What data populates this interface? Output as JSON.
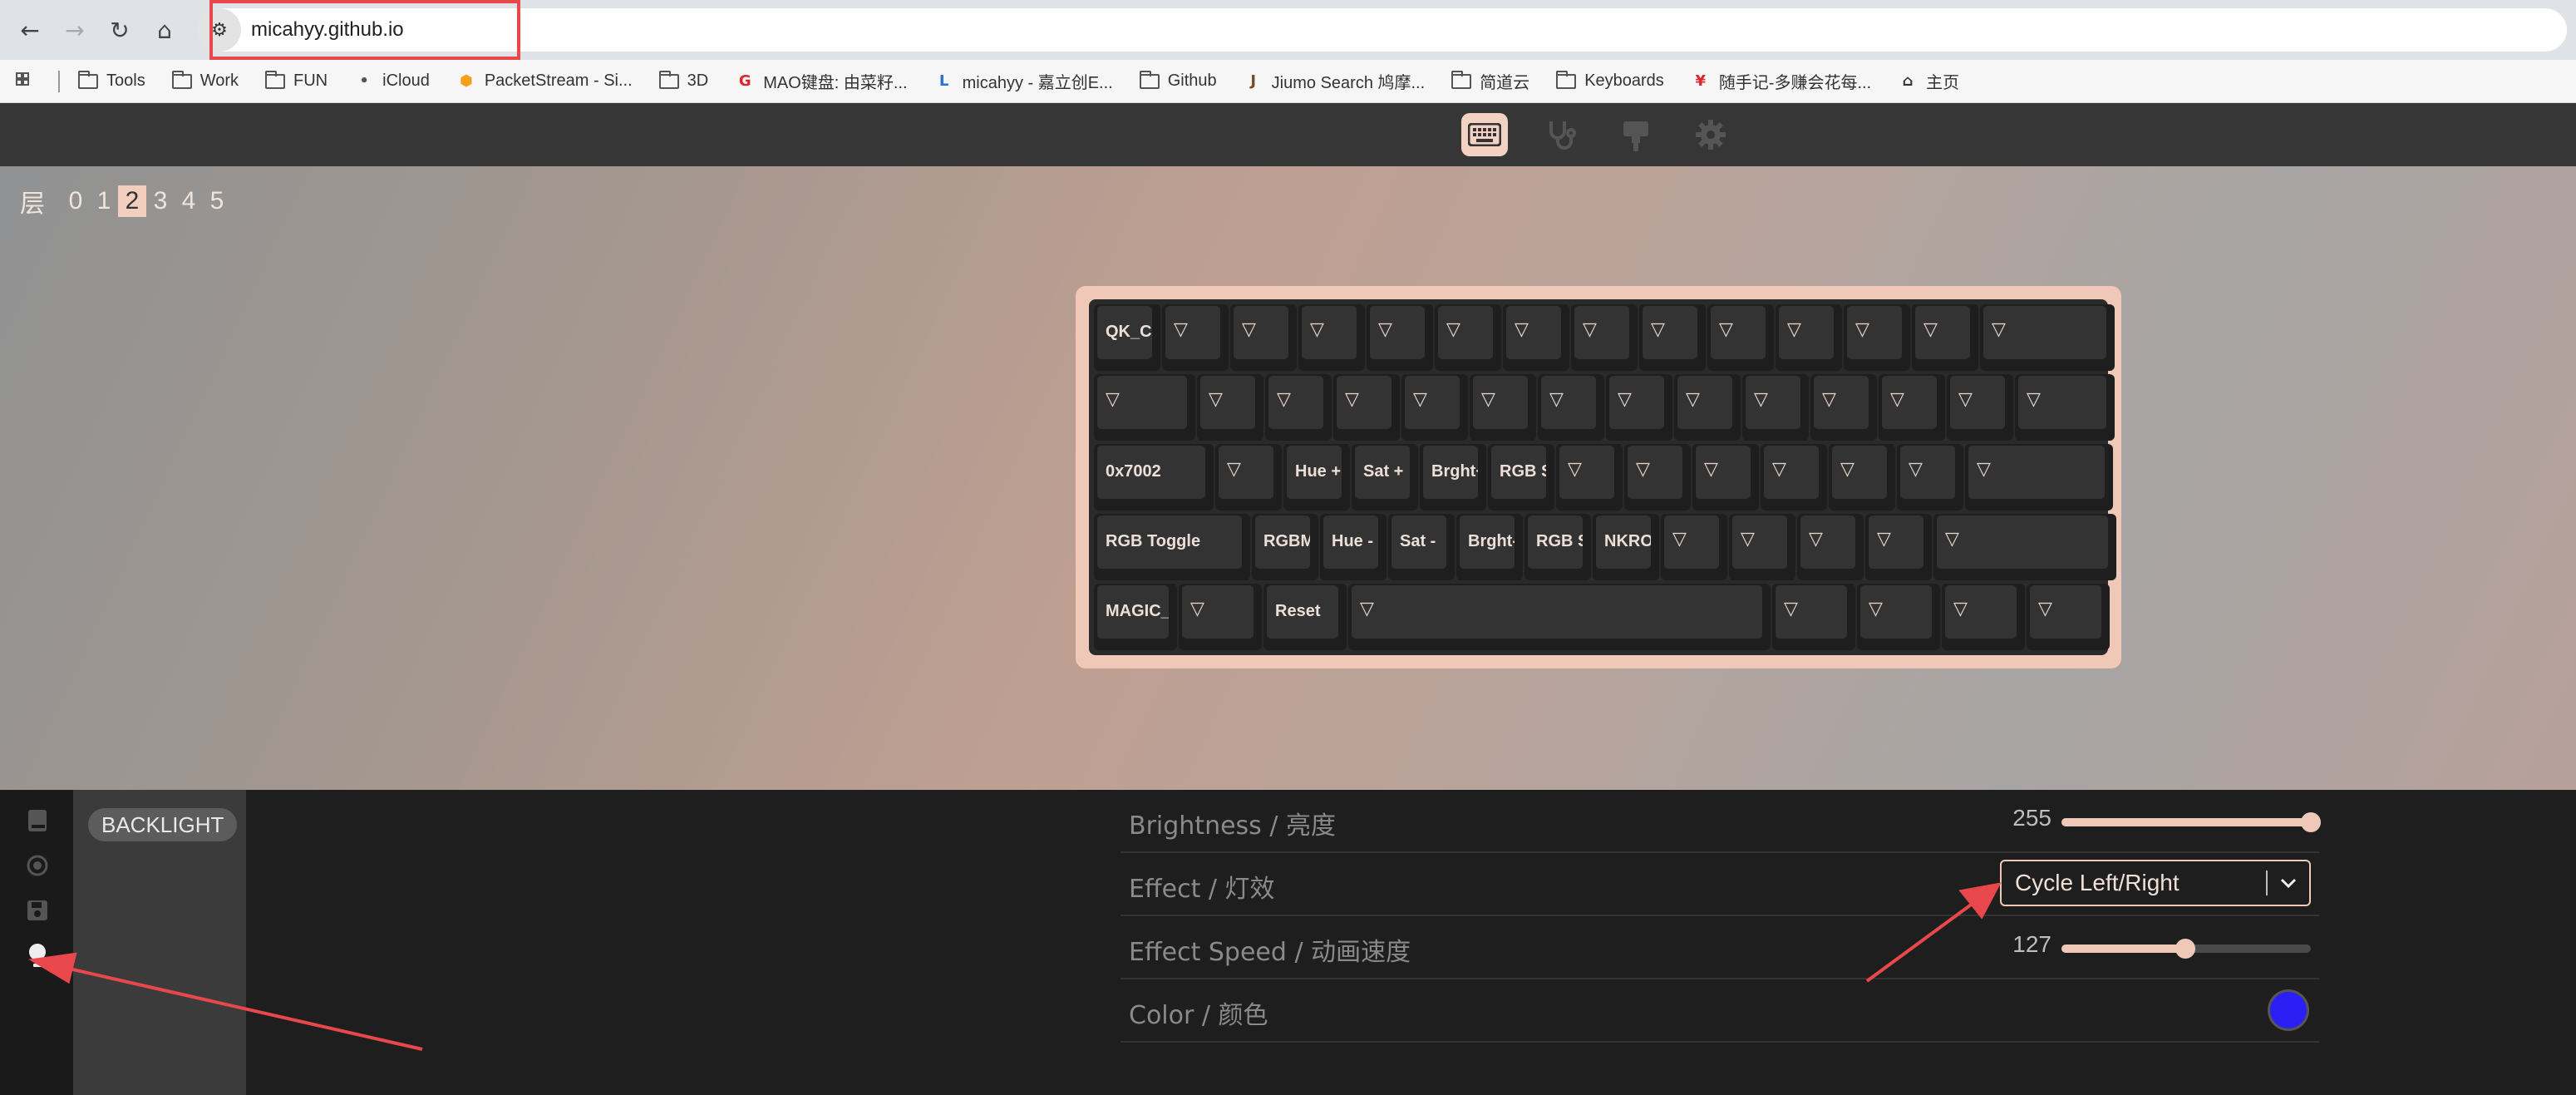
{
  "browser": {
    "url": "micahyy.github.io",
    "bookmarks": [
      {
        "icon": "folder-icon",
        "label": "Tools"
      },
      {
        "icon": "folder-icon",
        "label": "Work"
      },
      {
        "icon": "folder-icon",
        "label": "FUN"
      },
      {
        "icon": "apple-icon",
        "label": "iCloud"
      },
      {
        "icon": "packetstream-icon",
        "label": "PacketStream - Si..."
      },
      {
        "icon": "folder-icon",
        "label": "3D"
      },
      {
        "icon": "mao-icon",
        "label": "MAO键盘: 由菜籽..."
      },
      {
        "icon": "lceda-icon",
        "label": "micahyy - 嘉立创E..."
      },
      {
        "icon": "folder-icon",
        "label": "Github"
      },
      {
        "icon": "jiumo-icon",
        "label": "Jiumo Search 鸠摩..."
      },
      {
        "icon": "folder-icon",
        "label": "简道云"
      },
      {
        "icon": "folder-icon",
        "label": "Keyboards"
      },
      {
        "icon": "suishouji-icon",
        "label": "随手记-多赚会花每..."
      },
      {
        "icon": "home-icon",
        "label": "主页"
      }
    ]
  },
  "layers": {
    "label": "层",
    "items": [
      "0",
      "1",
      "2",
      "3",
      "4",
      "5"
    ],
    "active": "2"
  },
  "keyboard": {
    "rows": [
      [
        "QK_CL",
        "▽",
        "▽",
        "▽",
        "▽",
        "▽",
        "▽",
        "▽",
        "▽",
        "▽",
        "▽",
        "▽",
        "▽",
        "▽"
      ],
      [
        "▽",
        "▽",
        "▽",
        "▽",
        "▽",
        "▽",
        "▽",
        "▽",
        "▽",
        "▽",
        "▽",
        "▽",
        "▽",
        "▽"
      ],
      [
        "0x7002",
        "▽",
        "Hue +",
        "Sat +",
        "Brght+",
        "RGB Sl",
        "▽",
        "▽",
        "▽",
        "▽",
        "▽",
        "▽",
        "▽"
      ],
      [
        "RGB Toggle",
        "RGBMc",
        "Hue -",
        "Sat -",
        "Brght-",
        "RGB Sl",
        "NKRO",
        "▽",
        "▽",
        "▽",
        "▽",
        "▽"
      ],
      [
        "MAGIC_T",
        "▽",
        "Reset",
        "▽",
        "▽",
        "▽",
        "▽",
        "▽"
      ]
    ]
  },
  "panel": {
    "tab_label": "BACKLIGHT",
    "brightness": {
      "label": "Brightness / 亮度",
      "value": "255",
      "fraction": 1.0
    },
    "effect": {
      "label": "Effect / 灯效",
      "value": "Cycle Left/Right"
    },
    "speed": {
      "label": "Effect Speed / 动画速度",
      "value": "127",
      "fraction": 0.498
    },
    "color": {
      "label": "Color / 颜色",
      "value": "#2a1ff5"
    }
  },
  "colors": {
    "accent": "#f0c8b8",
    "annotation": "#e8484b"
  }
}
